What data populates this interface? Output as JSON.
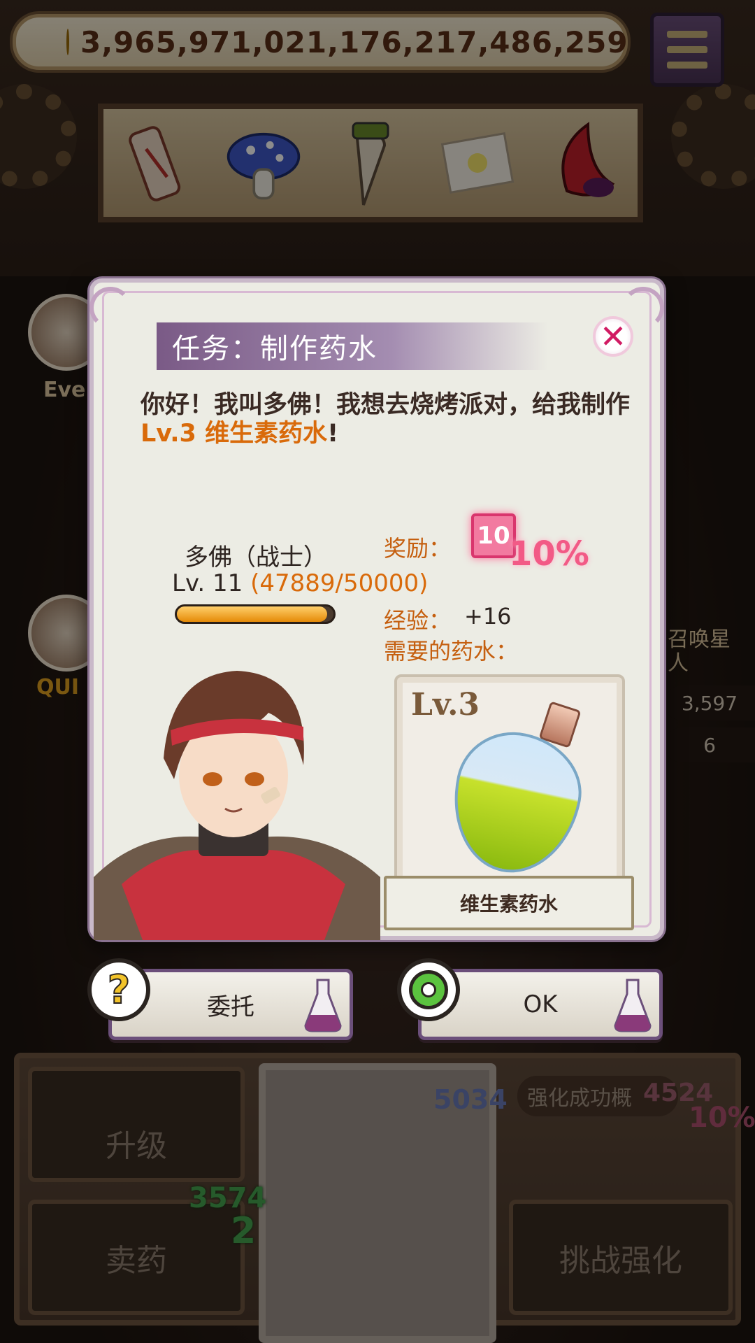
{
  "currency": {
    "amount": "3,965,971,021,176,217,486,259"
  },
  "dialog": {
    "title": "任务：制作药水",
    "close_symbol": "✕",
    "description_part1": "你好！我叫多佛！我想去烧烤派对，给我制作",
    "description_highlight": "Lv.3 维生素药水",
    "description_part2": "!",
    "customer_name": "多佛（战士）",
    "customer_level_prefix": "Lv. 11",
    "customer_xp": "(47889/50000)",
    "customer_xp_progress": 0.958,
    "reward_label": "奖励：",
    "reward_badge_num": "10",
    "reward_badge_pct": "10%",
    "exp_label": "经验：",
    "exp_value": "+16",
    "needed_label": "需要的药水：",
    "potion_level": "Lv.3",
    "potion_name": "维生素药水"
  },
  "actions": {
    "delegate_label": "委托",
    "ok_label": "OK"
  },
  "bottom_panel": {
    "upgrade_label": "升级",
    "sell_label": "卖药",
    "challenge_label": "挑战强化",
    "enhance_label": "强化成功概",
    "enhance_num": "4524",
    "enhance_pct": "10%",
    "shield_num": "5034",
    "green_num": "3574",
    "green_sub": "2"
  },
  "side": {
    "left_tag": "Eve",
    "left_tag2": "QUI",
    "right_label": "召唤星人",
    "right_stat1": "3,597",
    "right_stat2": "6"
  },
  "colors": {
    "accent_orange": "#d96a0a",
    "title_purple": "#7a5a86",
    "close_pink": "#d11b63"
  }
}
